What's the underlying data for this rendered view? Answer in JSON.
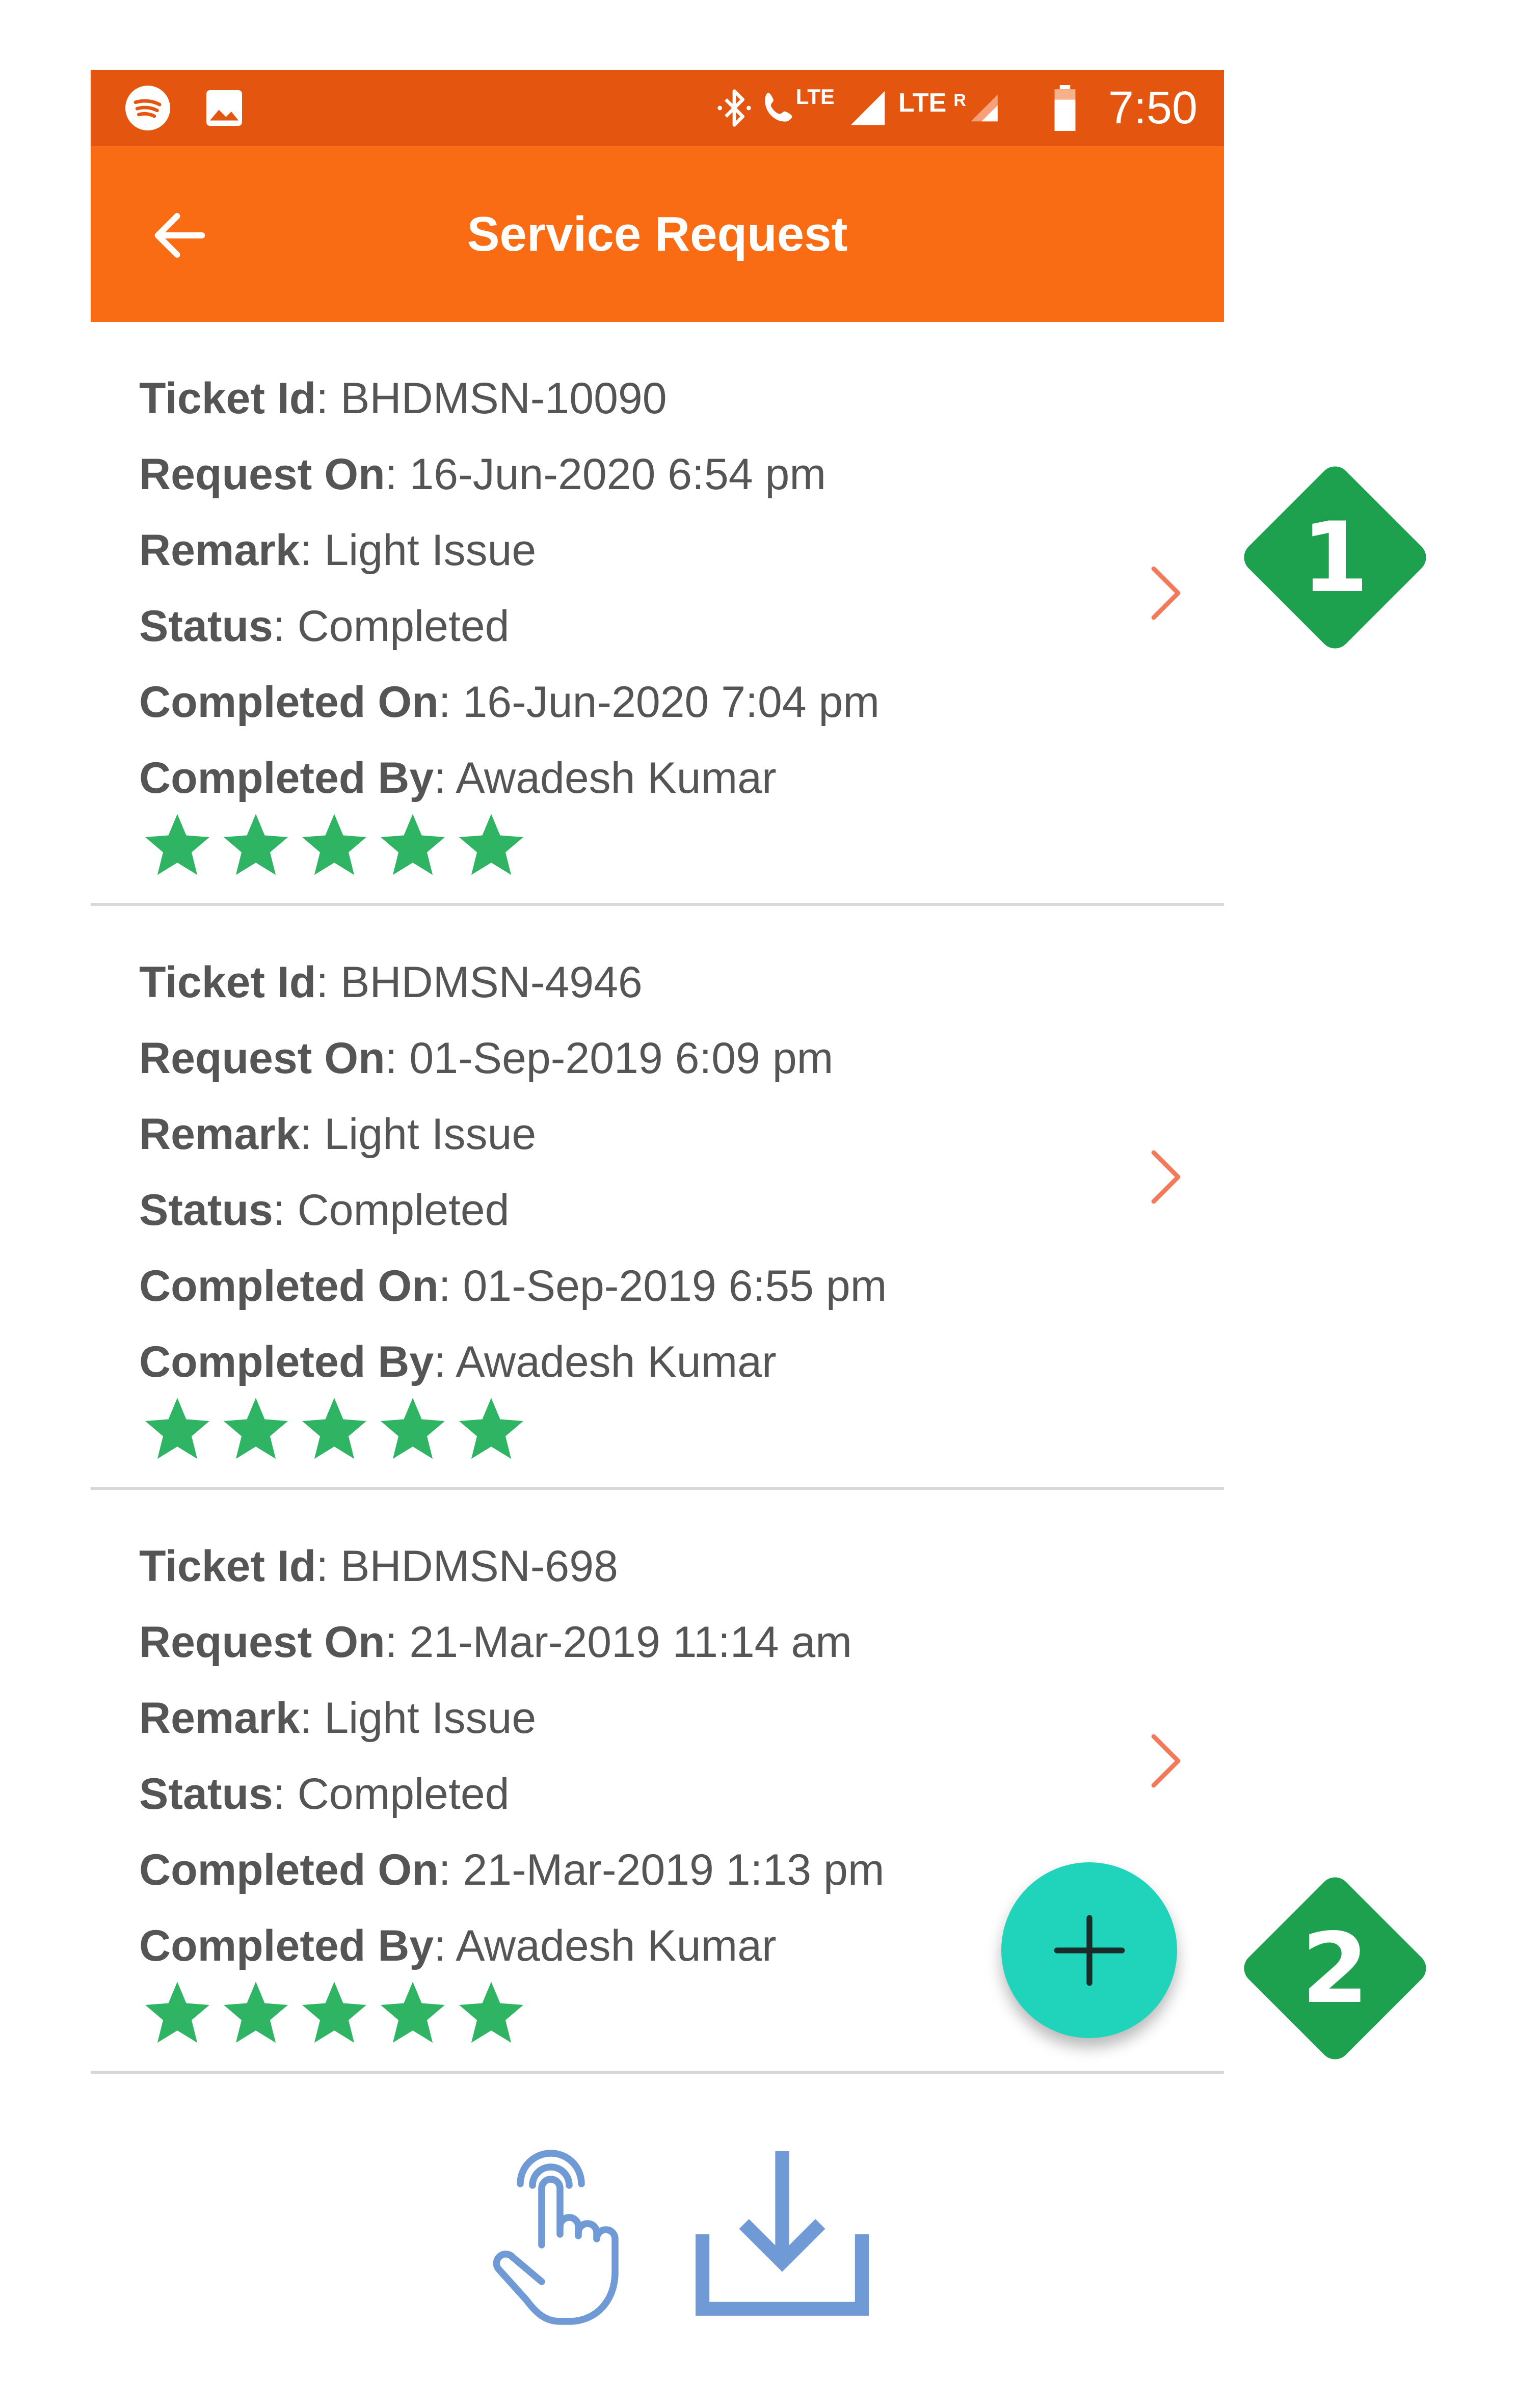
{
  "status_bar": {
    "time": "7:50",
    "network_label_1": "LTE",
    "network_label_2": "LTE",
    "roaming_label": "R",
    "icons": [
      "spotify-icon",
      "image-icon",
      "bluetooth-icon",
      "volte-call-icon",
      "signal-icon",
      "signal-roaming-icon",
      "battery-icon"
    ]
  },
  "app_bar": {
    "title": "Service Request",
    "back_icon": "arrow-left-icon"
  },
  "labels": {
    "ticket_id": "Ticket Id",
    "request_on": "Request On",
    "remark": "Remark",
    "status": "Status",
    "completed_on": "Completed On",
    "completed_by": "Completed By"
  },
  "tickets": [
    {
      "ticket_id": ": BHDMSN-10090",
      "request_on": ": 16-Jun-2020 6:54 pm",
      "remark": ": Light Issue",
      "status": ": Completed",
      "completed_on": ": 16-Jun-2020 7:04 pm",
      "completed_by": ": Awadesh Kumar",
      "rating": 5,
      "rating_max": 5
    },
    {
      "ticket_id": ": BHDMSN-4946",
      "request_on": ": 01-Sep-2019 6:09 pm",
      "remark": ": Light Issue",
      "status": ": Completed",
      "completed_on": ": 01-Sep-2019 6:55 pm",
      "completed_by": ": Awadesh Kumar",
      "rating": 5,
      "rating_max": 5
    },
    {
      "ticket_id": ": BHDMSN-698",
      "request_on": ": 21-Mar-2019 11:14 am",
      "remark": ": Light Issue",
      "status": ": Completed",
      "completed_on": ": 21-Mar-2019 1:13 pm",
      "completed_by": ": Awadesh Kumar",
      "rating": 5,
      "rating_max": 5
    }
  ],
  "fab": {
    "icon": "plus-icon"
  },
  "callouts": [
    {
      "number": "1"
    },
    {
      "number": "2"
    }
  ],
  "bottom_icons": [
    "tap-hand-icon",
    "download-icon"
  ],
  "colors": {
    "status_bar": "#e4560f",
    "app_bar": "#f96c13",
    "chevron": "#f27a5a",
    "star": "#2fb463",
    "fab": "#1fd4bb",
    "badge": "#1ea14e",
    "bottom_icons": "#6f9ad6",
    "label_text": "#555555"
  }
}
